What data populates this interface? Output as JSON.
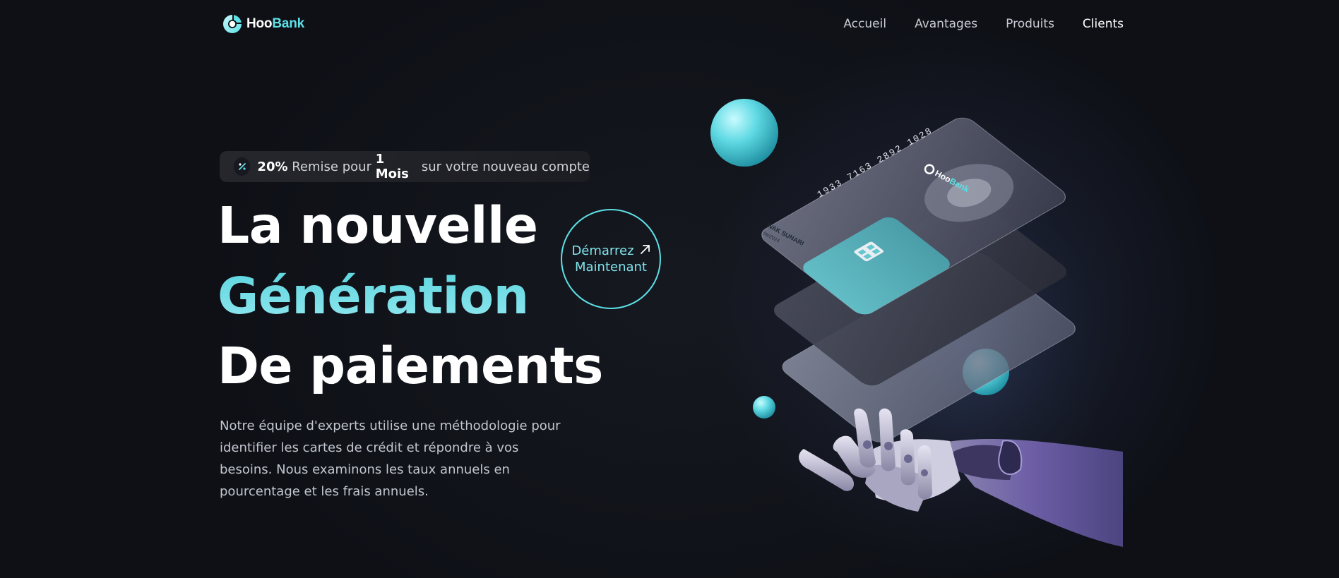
{
  "brand": {
    "name_part1": "Hoo",
    "name_part2": "Bank"
  },
  "nav": {
    "items": [
      {
        "label": "Accueil"
      },
      {
        "label": "Avantages"
      },
      {
        "label": "Produits"
      },
      {
        "label": "Clients"
      }
    ],
    "active_item": "Clients"
  },
  "promo": {
    "icon": "discount-icon",
    "percent": "20%",
    "text1": " Remise pour ",
    "duration": "1 Mois",
    "text2": " sur votre nouveau compte"
  },
  "hero": {
    "line1": "La nouvelle",
    "line2": "Génération",
    "line3": "De paiements",
    "description": "Notre équipe d'experts utilise une méthodologie pour identifier les cartes de crédit et répondre à vos besoins. Nous examinons les taux annuels en pourcentage et les frais annuels."
  },
  "cta": {
    "line1": "Démarrez",
    "line2": "Maintenant",
    "icon": "arrow-up-right-icon"
  },
  "illustration": {
    "card_number": "1933 7163 2892 1028",
    "card_holder": "WAK SUNARI",
    "card_expiry": "09/2024",
    "card_brand_part1": "Hoo",
    "card_brand_part2": "Bank"
  },
  "colors": {
    "accent": "#5ce1e6",
    "background": "#0e1016",
    "text_muted": "#c2c6cf"
  }
}
